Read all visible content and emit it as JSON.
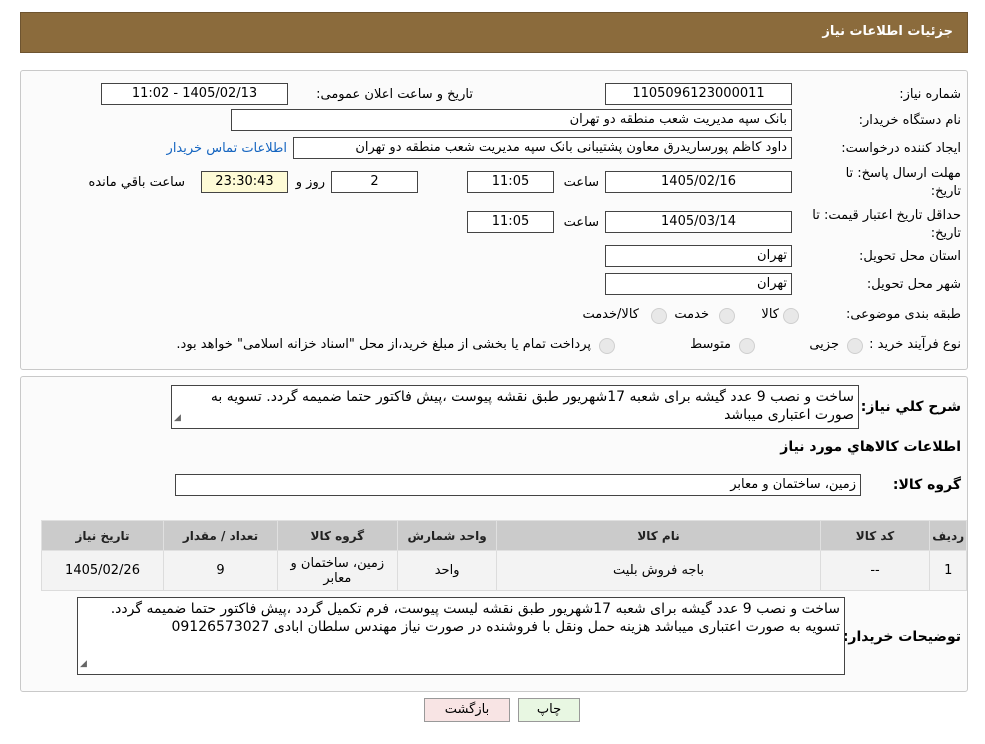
{
  "header": {
    "title": "جزئیات اطلاعات نیاز"
  },
  "need": {
    "number_label": "شماره نیاز:",
    "number": "1105096123000011",
    "announce_label": "تاریخ و ساعت اعلان عمومی:",
    "announce_value": "1405/02/13 - 11:02",
    "buyer_label": "نام دستگاه خریدار:",
    "buyer": "بانک سپه مدیریت شعب منطقه دو تهران",
    "creator_label": "ایجاد کننده درخواست:",
    "creator": "داود کاظم پورساریدرق معاون پشتیبانی بانک سپه مدیریت شعب منطقه دو تهران",
    "contact_link": "اطلاعات تماس خریدار",
    "deadline_label": "مهلت ارسال پاسخ: تا تاریخ:",
    "deadline_date": "1405/02/16",
    "time_label": "ساعت",
    "deadline_time": "11:05",
    "days": "2",
    "days_label": "روز و",
    "remaining": "23:30:43",
    "remaining_label": "ساعت باقي مانده",
    "validity_label": "حداقل تاریخ اعتبار قیمت: تا تاریخ:",
    "validity_date": "1405/03/14",
    "validity_time": "11:05",
    "province_label": "استان محل تحویل:",
    "province": "تهران",
    "city_label": "شهر محل تحویل:",
    "city": "تهران",
    "category_label": "طبقه بندی موضوعی:",
    "category_options": [
      "کالا",
      "خدمت",
      "کالا/خدمت"
    ],
    "process_label": "نوع فرآیند خرید :",
    "process_options": [
      "جزیی",
      "متوسط"
    ],
    "process_note": "پرداخت تمام یا بخشی از مبلغ خرید،از محل \"اسناد خزانه اسلامی\" خواهد بود."
  },
  "details": {
    "desc_label": "شرح کلي نياز:",
    "desc": "ساخت و نصب 9 عدد گیشه برای شعبه 17شهریور طبق نقشه پیوست ،پیش فاکتور حتما ضمیمه گردد. تسویه به صورت اعتباری میباشد",
    "goods_title": "اطلاعات کالاهاي مورد نياز",
    "group_label": "گروه کالا:",
    "group": "زمین، ساختمان و معابر",
    "table_headers": [
      "ردیف",
      "کد کالا",
      "نام کالا",
      "واحد شمارش",
      "گروه کالا",
      "تعداد / مقدار",
      "تاریخ نیاز"
    ],
    "rows": [
      [
        "1",
        "--",
        "باجه فروش بلیت",
        "واحد",
        "زمین، ساختمان و معابر",
        "9",
        "1405/02/26"
      ]
    ],
    "buyer_notes_label": "توضیحات خریدار:",
    "buyer_notes": "ساخت و نصب 9 عدد گیشه برای شعبه 17شهریور طبق نقشه لیست پیوست، فرم تکمیل گردد ،پیش فاکتور حتما ضمیمه گردد. تسویه به صورت اعتباری میباشد هزینه حمل ونقل با فروشنده در صورت نیاز مهندس سلطان ابادی 09126573027"
  },
  "buttons": {
    "print": "چاپ",
    "back": "بازگشت"
  },
  "colors": {
    "header": "#8b6b3c",
    "link": "#1565c0",
    "remaining_bg": "#fefbd6"
  }
}
